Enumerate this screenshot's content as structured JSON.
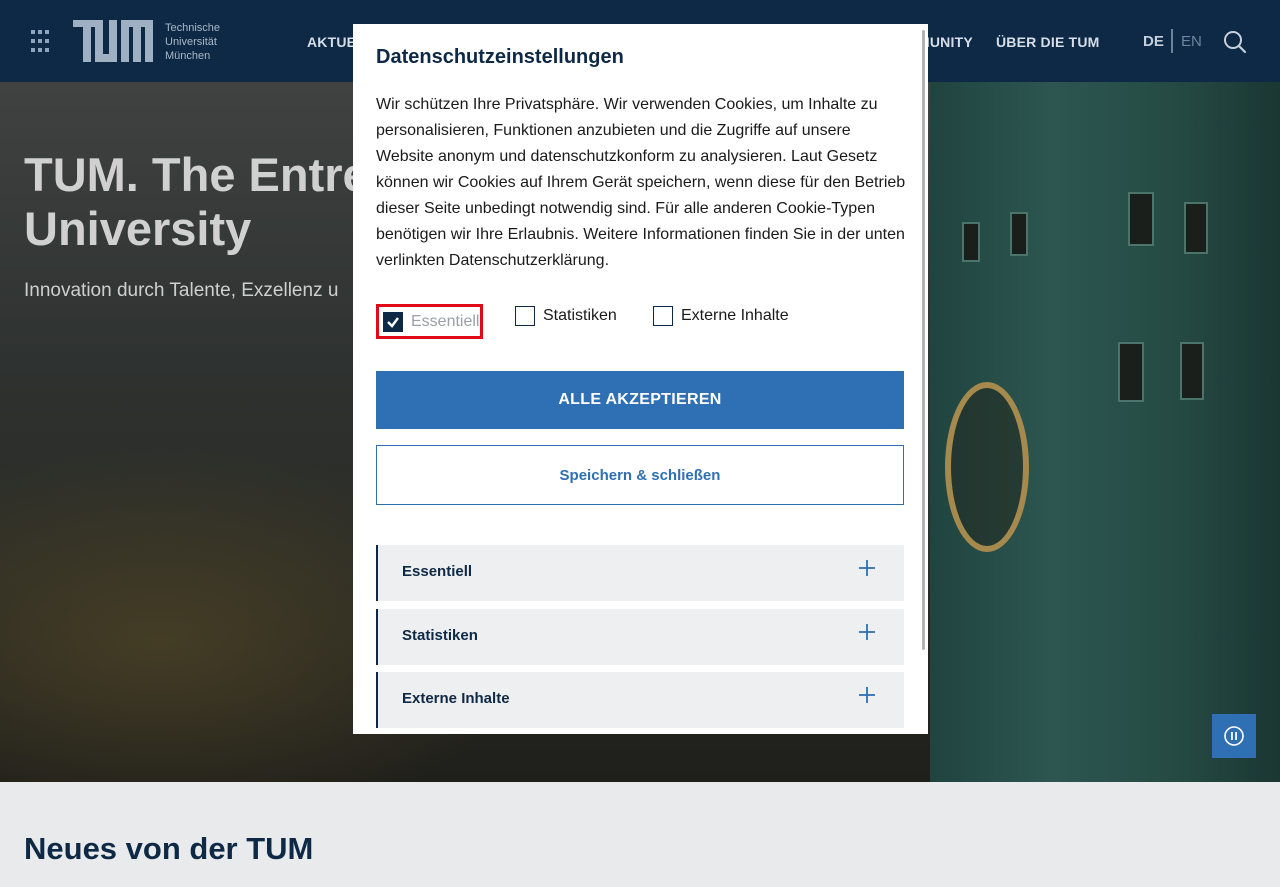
{
  "header": {
    "logo_text": [
      "Technische",
      "Universität",
      "München"
    ],
    "nav_left": "AKTUE",
    "nav_community": "MUNITY",
    "nav_about": "ÜBER DIE TUM",
    "lang_de": "DE",
    "lang_en": "EN"
  },
  "hero": {
    "title_line1": "TUM. The Entre",
    "title_line2": "University",
    "subtitle": "Innovation durch Talente, Exzellenz u"
  },
  "news": {
    "title": "Neues von der TUM"
  },
  "modal": {
    "title": "Datenschutzeinstellungen",
    "text": "Wir schützen Ihre Privatsphäre. Wir verwenden Cookies, um Inhalte zu personalisieren, Funktionen anzubieten und die Zugriffe auf unsere Website anonym und datenschutzkonform zu analysieren. Laut Gesetz können wir Cookies auf Ihrem Gerät speichern, wenn diese für den Betrieb dieser Seite unbedingt notwendig sind. Für alle anderen Cookie-Typen benötigen wir Ihre Erlaubnis. Weitere Informationen finden Sie in der unten verlinkten Datenschutzerklärung.",
    "checkboxes": [
      {
        "label": "Essentiell",
        "checked": true
      },
      {
        "label": "Statistiken",
        "checked": false
      },
      {
        "label": "Externe Inhalte",
        "checked": false
      }
    ],
    "accept_all": "ALLE AKZEPTIEREN",
    "save_close": "Speichern & schließen",
    "accordion": [
      {
        "label": "Essentiell"
      },
      {
        "label": "Statistiken"
      },
      {
        "label": "Externe Inhalte"
      }
    ]
  },
  "colors": {
    "header_bg": "#0e2945",
    "primary": "#2f6fb3",
    "highlight_border": "#e00b16"
  }
}
